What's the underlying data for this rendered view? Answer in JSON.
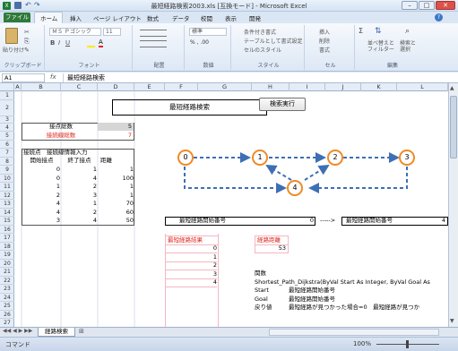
{
  "window": {
    "title": "最短経路検索2003.xls [互換モード] - Microsoft Excel",
    "min": "–",
    "max": "□",
    "close": "✕"
  },
  "ribbon_tabs": {
    "file": "ファイル",
    "home": "ホーム",
    "insert": "挿入",
    "layout": "ページ レイアウト",
    "formulas": "数式",
    "data": "データ",
    "review": "校閲",
    "view": "表示",
    "dev": "開発"
  },
  "ribbon": {
    "paste": "貼り付け",
    "clipboard": "クリップボード",
    "font_name": "ＭＳ Ｐゴシック",
    "font_size": "11",
    "font": "フォント",
    "align": "配置",
    "number_format": "標準",
    "number": "数値",
    "cond_fmt": "条件付き書式",
    "table_fmt": "テーブルとして書式設定",
    "cell_style": "セルのスタイル",
    "style": "スタイル",
    "ins": "挿入",
    "del": "削除",
    "fmt": "書式",
    "cells": "セル",
    "sort": "並べ替えと\nフィルター",
    "find": "検索と\n選択",
    "edit": "編集"
  },
  "formula_bar": {
    "name_box": "A1",
    "fx": "fx",
    "formula": "最短経路検索"
  },
  "columns": [
    "A",
    "B",
    "C",
    "D",
    "E",
    "F",
    "G",
    "H",
    "I",
    "J",
    "K",
    "L"
  ],
  "rows": [
    "1",
    "2",
    "3",
    "4",
    "5",
    "6",
    "7",
    "8",
    "9",
    "10",
    "11",
    "12",
    "13",
    "14",
    "15",
    "16",
    "17",
    "18",
    "19",
    "20",
    "21",
    "22",
    "23",
    "24",
    "25",
    "26",
    "27"
  ],
  "sheet": {
    "title": "最短経路検索",
    "search_button": "検索実行",
    "node_count_label": "接点総数",
    "node_count": "5",
    "edge_count_label": "接続線総数",
    "edge_count": "7",
    "input_header": "接続点　接続線情報入力",
    "col_start": "開始接点",
    "col_end": "終了接点",
    "col_dist": "距離",
    "edges": [
      {
        "s": "0",
        "e": "1",
        "d": "1"
      },
      {
        "s": "0",
        "e": "4",
        "d": "100"
      },
      {
        "s": "1",
        "e": "2",
        "d": "1"
      },
      {
        "s": "2",
        "e": "3",
        "d": "1"
      },
      {
        "s": "4",
        "e": "1",
        "d": "70"
      },
      {
        "s": "4",
        "e": "2",
        "d": "60"
      },
      {
        "s": "3",
        "e": "4",
        "d": "50"
      }
    ],
    "start_label": "最短経路開始番号",
    "start_val": "0",
    "arrow": "----->",
    "end_label": "最短経路開始番号",
    "end_val": "4",
    "result_label": "最短経路結果",
    "results": [
      "0",
      "1",
      "2",
      "3",
      "4"
    ],
    "dist_label": "経路距離",
    "dist_val": "53",
    "func_label": "関数",
    "func_sig": "Shortest_Path_Dijkstra(ByVal Start As Integer, ByVal Goal As",
    "start_k": "Start",
    "start_desc": "最短経路開始番号",
    "goal_k": "Goal",
    "goal_desc": "最短経路開始番号",
    "ret_k": "戻り値",
    "ret_desc": "最短経路が見つかった場合=0　最短経路が見つか",
    "nodes": [
      "0",
      "1",
      "2",
      "3",
      "4"
    ]
  },
  "sheet_tab": "経路検索",
  "status": {
    "ready": "コマンド",
    "zoom": "100%"
  },
  "colors": {
    "node_border": "#f08a24",
    "edge": "#3d6fb5",
    "red": "#e0261b",
    "pink": "#f3b7c3"
  }
}
